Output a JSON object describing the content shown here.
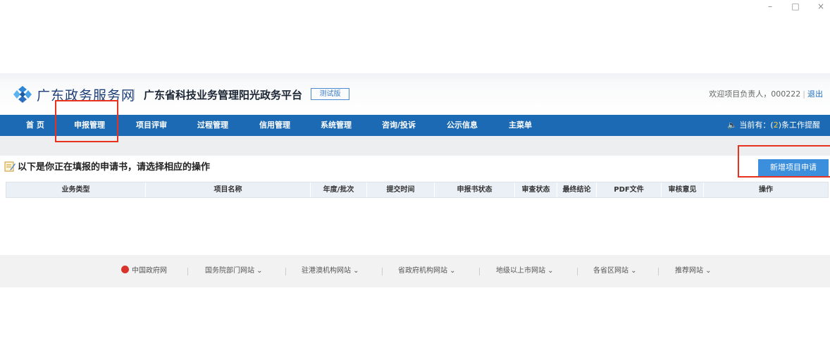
{
  "window": {
    "minimize": "–",
    "maximize": "□",
    "close": "×"
  },
  "header": {
    "brand": "广东政务服务网",
    "platform": "广东省科技业务管理阳光政务平台",
    "badge": "测试版",
    "welcome": "欢迎项目负责人，000222",
    "logout": "退出"
  },
  "nav": {
    "items": [
      "首 页",
      "申报管理",
      "项目评审",
      "过程管理",
      "信用管理",
      "系统管理",
      "咨询/投诉",
      "公示信息",
      "主菜单"
    ],
    "notice_prefix": "当前有：(",
    "notice_count": "2",
    "notice_suffix": ")条工作提醒"
  },
  "main": {
    "title": "以下是你正在填报的申请书，请选择相应的操作",
    "new_button": "新增项目申请",
    "columns": [
      "业务类型",
      "项目名称",
      "年度/批次",
      "提交时间",
      "申报书状态",
      "审查状态",
      "最终结论",
      "PDF文件",
      "审核意见",
      "操作"
    ]
  },
  "footer": {
    "links": [
      "中国政府网",
      "国务院部门网站",
      "驻港澳机构网站",
      "省政府机构网站",
      "地级以上市网站",
      "各省区网站",
      "推荐网站"
    ]
  },
  "colors": {
    "nav_bg": "#1c6ab4",
    "button": "#3c8fdd",
    "highlight": "#e8321f"
  }
}
